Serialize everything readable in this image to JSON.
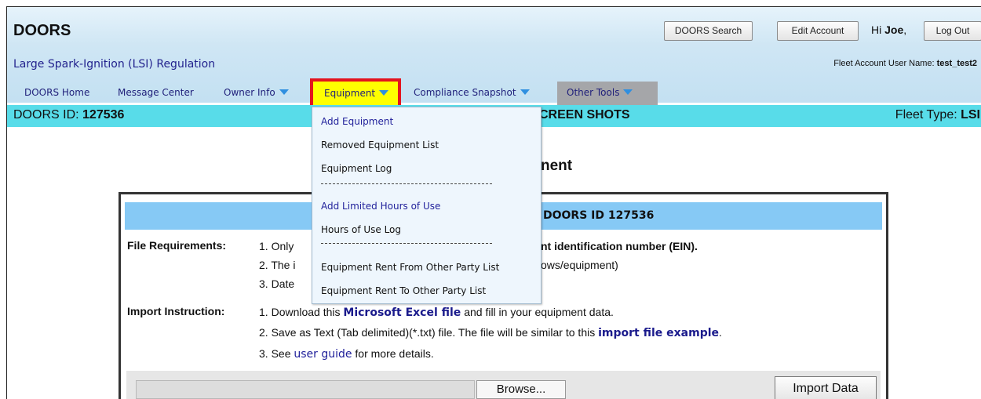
{
  "app": {
    "title": "DOORS",
    "subtitle": "Large Spark-Ignition (LSI) Regulation",
    "buttons": {
      "search": "DOORS Search",
      "edit_account": "Edit Account",
      "logout": "Log Out"
    },
    "greeting_prefix": "Hi",
    "greeting_name": "Joe",
    "greeting_suffix": ",",
    "fleet_user_label": "Fleet Account User Name:",
    "fleet_user_value": "test_test2"
  },
  "nav": {
    "items": [
      "DOORS Home",
      "Message Center",
      "Owner Info",
      "Equipment",
      "Compliance Snapshot",
      "Other Tools"
    ],
    "highlight_color": "#ffff00",
    "active_outline_color": "#e3141f"
  },
  "idbar": {
    "id_label": "DOORS ID:",
    "id_value": "127536",
    "center_text": "CREEN SHOTS",
    "fleet_type_label": "Fleet Type:",
    "fleet_type_value": "LSI"
  },
  "page": {
    "title_partial": "nent"
  },
  "panel": {
    "heading_partial": "DOORS ID 127536",
    "file_req_label": "File Requirements:",
    "file_req": [
      {
        "num": "1.",
        "text_a": "Only",
        "text_b": "nt identification number (EIN)."
      },
      {
        "num": "2.",
        "text_a": "The i",
        "text_b": "ows/equipment)"
      },
      {
        "num": "3.",
        "text_a": "Date"
      }
    ],
    "import_label": "Import Instruction:",
    "import_steps": [
      {
        "num": "1.",
        "before": "Download this",
        "link": "Microsoft Excel file",
        "after": "and fill in your equipment data."
      },
      {
        "num": "2.",
        "before": "Save as Text (Tab delimited)(*.txt) file. The file will be similar to this",
        "link": "import file example",
        "after": "."
      },
      {
        "num": "3.",
        "before": "See",
        "link": "user guide",
        "after": "for more details."
      }
    ],
    "browse_label": "Browse...",
    "import_button": "Import Data"
  },
  "menu": {
    "group1": [
      "Add Equipment",
      "Removed Equipment List",
      "Equipment Log"
    ],
    "group2": [
      "Add Limited Hours of Use",
      "Hours of Use Log"
    ],
    "group3": [
      "Equipment Rent From Other Party List",
      "Equipment Rent To Other Party List"
    ]
  }
}
